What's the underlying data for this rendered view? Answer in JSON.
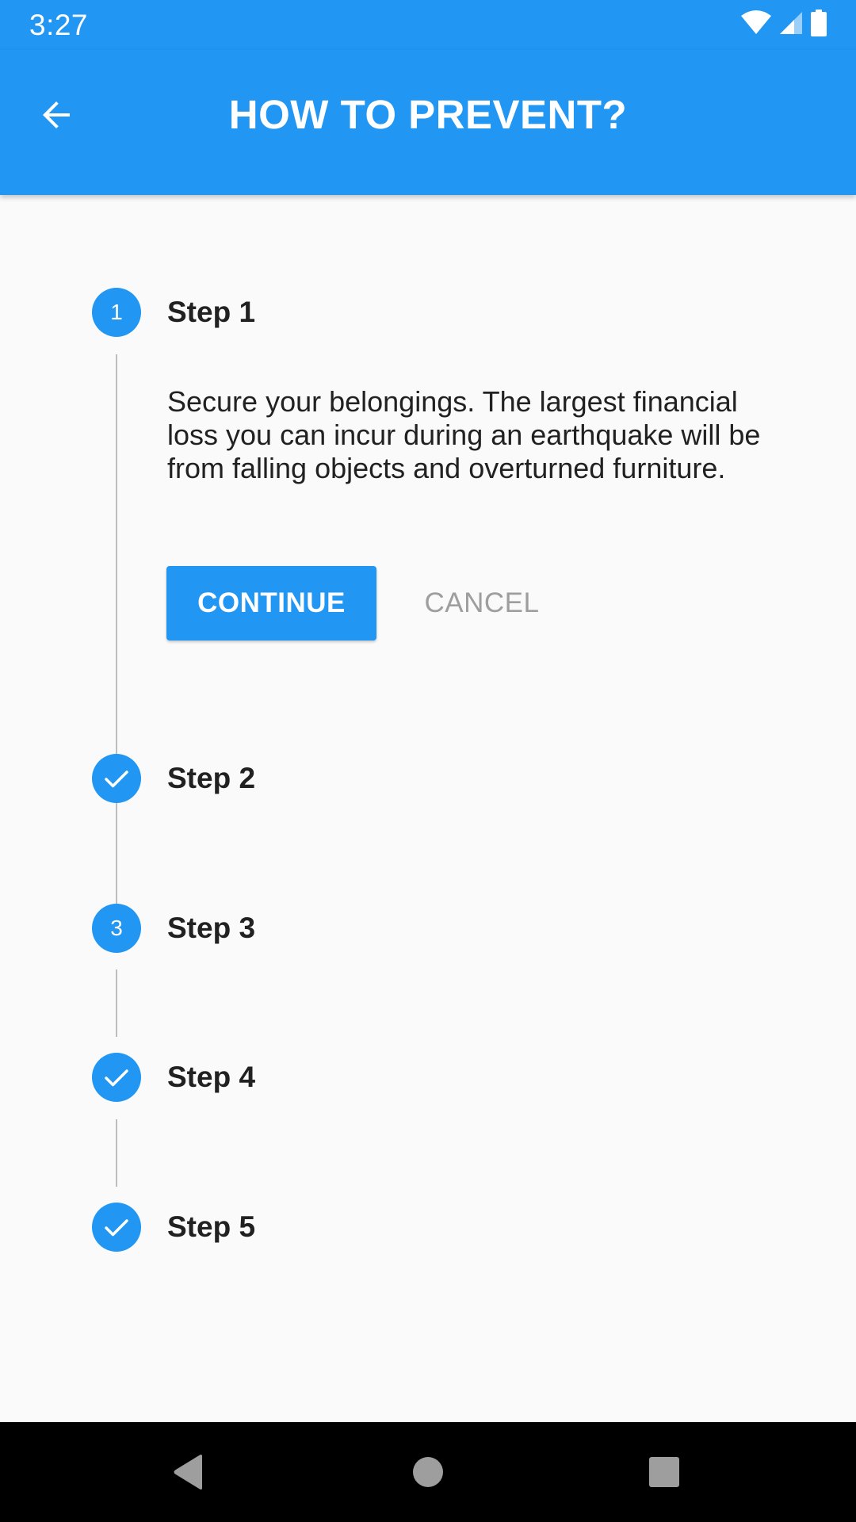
{
  "status_bar": {
    "time": "3:27",
    "icons": [
      "wifi-icon",
      "cell-signal-icon",
      "battery-icon"
    ]
  },
  "app_bar": {
    "title": "HOW TO PREVENT?",
    "back_icon": "arrow-back-icon",
    "background_color": "#2196f3"
  },
  "stepper": {
    "accent_color": "#2196f3",
    "steps": [
      {
        "label": "Step 1",
        "badge": "1",
        "state": "active",
        "icon": ""
      },
      {
        "label": "Step 2",
        "badge": "",
        "state": "complete",
        "icon": "check-icon"
      },
      {
        "label": "Step 3",
        "badge": "3",
        "state": "indexed",
        "icon": ""
      },
      {
        "label": "Step 4",
        "badge": "",
        "state": "complete",
        "icon": "check-icon"
      },
      {
        "label": "Step 5",
        "badge": "",
        "state": "complete",
        "icon": "check-icon"
      }
    ],
    "active_content": {
      "description": "Secure your belongings. The largest financial loss you can incur during an earthquake will be from falling objects and overturned furniture.",
      "continue_label": "CONTINUE",
      "cancel_label": "CANCEL"
    }
  },
  "nav_bar": {
    "buttons": [
      "back-triangle-icon",
      "home-circle-icon",
      "recents-square-icon"
    ]
  }
}
